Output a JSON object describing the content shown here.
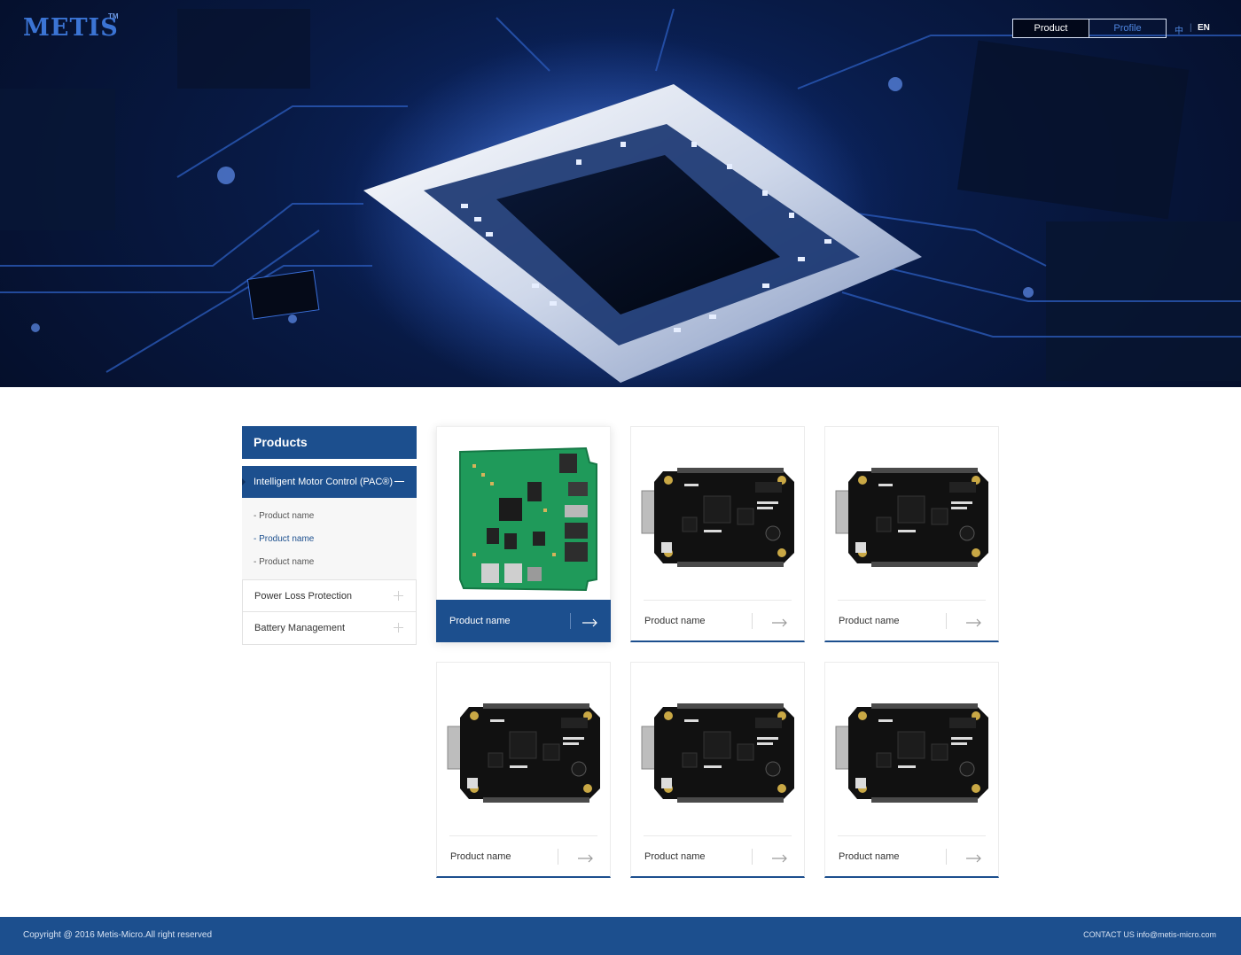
{
  "header": {
    "logo": "METIS",
    "logo_tm": "TM",
    "nav": [
      {
        "label": "Product",
        "active": true
      },
      {
        "label": "Profile",
        "active": false
      }
    ],
    "lang_zh": "中",
    "lang_sep": "|",
    "lang_en": "EN"
  },
  "sidebar": {
    "title": "Products",
    "active_category": "Intelligent Motor Control (PAC®)",
    "sub_items": [
      "- Product name",
      "- Product name",
      "- Product name"
    ],
    "categories": [
      "Power Loss Protection",
      "Battery Management"
    ]
  },
  "products": [
    {
      "name": "Product name",
      "image": "green-board"
    },
    {
      "name": "Product name",
      "image": "black-board"
    },
    {
      "name": "Product name",
      "image": "black-board"
    },
    {
      "name": "Product name",
      "image": "black-board"
    },
    {
      "name": "Product name",
      "image": "black-board"
    },
    {
      "name": "Product name",
      "image": "black-board"
    }
  ],
  "footer": {
    "copyright": "Copyright @ 2016 Metis-Micro.All right reserved",
    "contact": "CONTACT US info@metis-micro.com"
  },
  "colors": {
    "brand": "#1c4f8e",
    "accent": "#3b74d4"
  }
}
